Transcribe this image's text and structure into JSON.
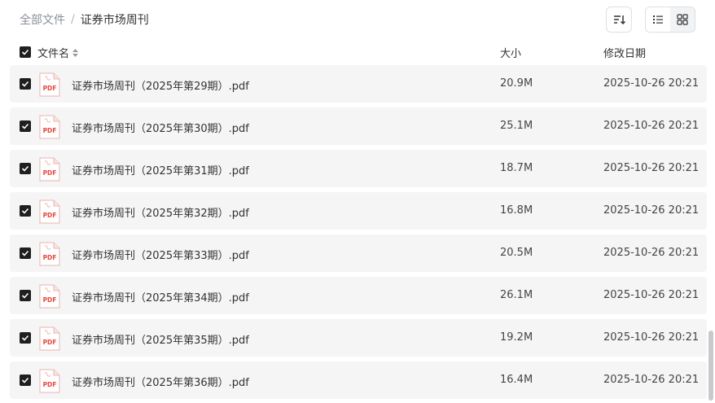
{
  "breadcrumb": {
    "root": "全部文件",
    "separator": "/",
    "current": "证券市场周刊"
  },
  "toolbar": {
    "sort_icon": "sort-descending-icon",
    "view_list_icon": "list-view-icon",
    "view_grid_icon": "grid-view-icon",
    "active_view": "list"
  },
  "table": {
    "columns": {
      "name": "文件名",
      "size": "大小",
      "modified": "修改日期"
    },
    "select_all_checked": true,
    "rows": [
      {
        "name": "证券市场周刊（2025年第29期）.pdf",
        "size": "20.9M",
        "modified": "2025-10-26 20:21",
        "checked": true
      },
      {
        "name": "证券市场周刊（2025年第30期）.pdf",
        "size": "25.1M",
        "modified": "2025-10-26 20:21",
        "checked": true
      },
      {
        "name": "证券市场周刊（2025年第31期）.pdf",
        "size": "18.7M",
        "modified": "2025-10-26 20:21",
        "checked": true
      },
      {
        "name": "证券市场周刊（2025年第32期）.pdf",
        "size": "16.8M",
        "modified": "2025-10-26 20:21",
        "checked": true
      },
      {
        "name": "证券市场周刊（2025年第33期）.pdf",
        "size": "20.5M",
        "modified": "2025-10-26 20:21",
        "checked": true
      },
      {
        "name": "证券市场周刊（2025年第34期）.pdf",
        "size": "26.1M",
        "modified": "2025-10-26 20:21",
        "checked": true
      },
      {
        "name": "证券市场周刊（2025年第35期）.pdf",
        "size": "19.2M",
        "modified": "2025-10-26 20:21",
        "checked": true
      },
      {
        "name": "证券市场周刊（2025年第36期）.pdf",
        "size": "16.4M",
        "modified": "2025-10-26 20:21",
        "checked": true
      }
    ]
  },
  "file_icon": {
    "name": "pdf-file-icon",
    "label": "PDF",
    "color": "#e5483e"
  },
  "colors": {
    "row_background": "#f5f5f6",
    "checkbox": "#1f1f1f",
    "muted_text": "#8a8f99"
  }
}
